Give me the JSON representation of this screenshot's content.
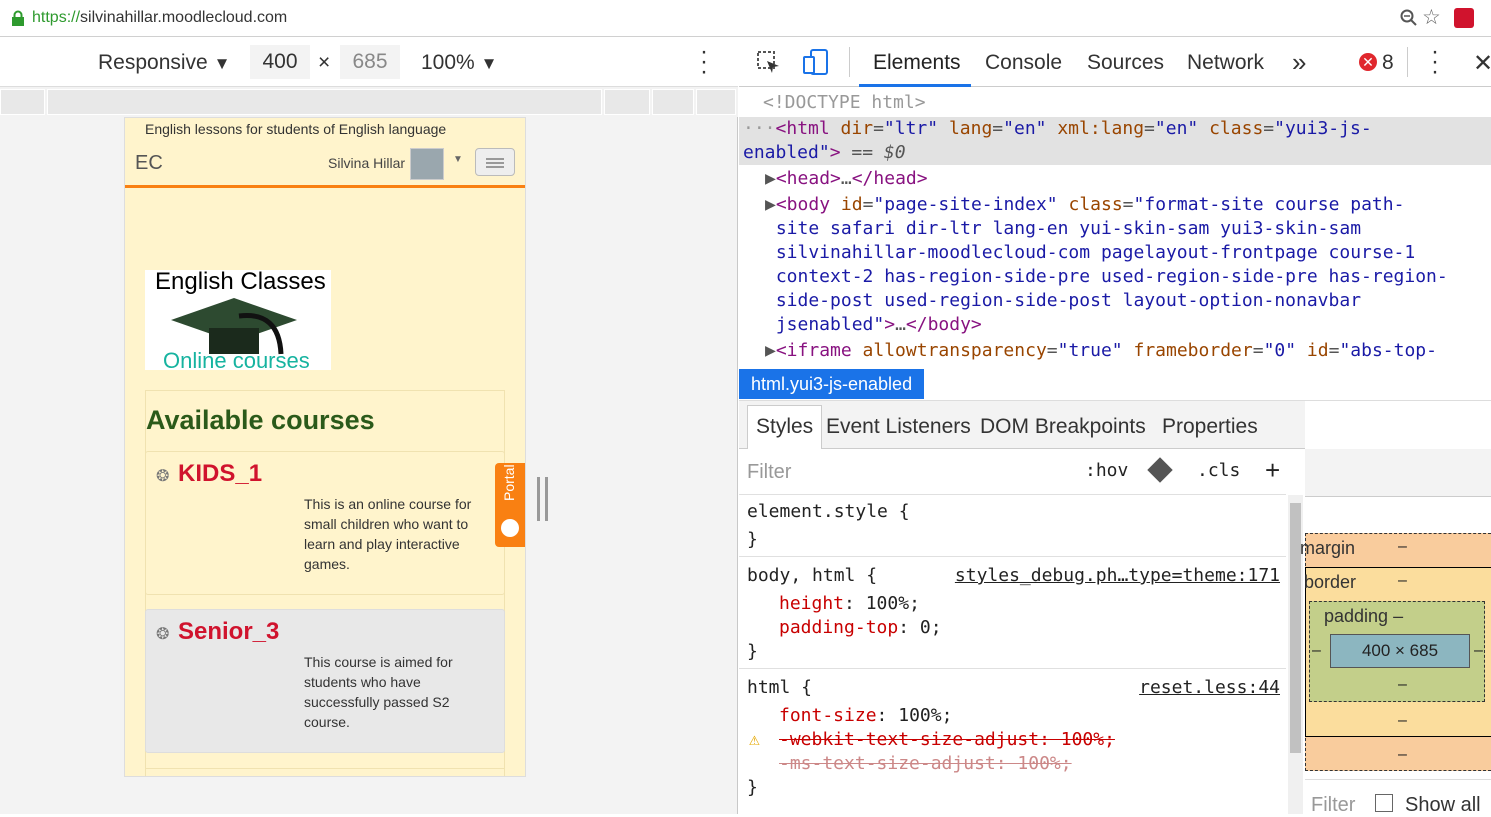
{
  "browser": {
    "url_scheme": "https://",
    "url_host": "silvinahillar.moodlecloud.com"
  },
  "device_toolbar": {
    "mode": "Responsive",
    "width": "400",
    "times": "×",
    "height": "685",
    "zoom": "100%"
  },
  "site": {
    "top_text": "English lessons for students of English language",
    "brand": "EC",
    "user": "Silvina Hillar",
    "logo_title": "English Classes",
    "logo_sub": "Online courses",
    "section_title": "Available courses",
    "portal_label": "Portal",
    "courses": [
      {
        "name": "KIDS_1",
        "desc": [
          "This is an online course for",
          "small children who want to",
          "learn and play interactive",
          "games."
        ]
      },
      {
        "name": "Senior_3",
        "desc": [
          "This course is aimed for",
          "students who have",
          "successfully passed S2",
          "course."
        ]
      }
    ]
  },
  "devtools": {
    "tabs": [
      "Elements",
      "Console",
      "Sources",
      "Network"
    ],
    "more": "»",
    "error_count": "8",
    "breadcrumb": "html.yui3-js-enabled",
    "subtabs": [
      "Styles",
      "Event Listeners",
      "DOM Breakpoints",
      "Properties"
    ],
    "filter_placeholder": "Filter",
    "hov": ":hov",
    "cls": ".cls",
    "plus": "+",
    "doctype": "<!DOCTYPE html>",
    "styles": {
      "element_style": "element.style {",
      "close": "}",
      "r1_sel": "body, html {",
      "r1_src": "styles_debug.ph…type=theme:171",
      "r1_p1": "height",
      "r1_v1": "100%;",
      "r1_p2": "padding-top",
      "r1_v2": "0;",
      "r2_sel": "html {",
      "r2_src": "reset.less:44",
      "r2_p1": "font-size",
      "r2_v1": "100%;",
      "r2_p2": "-webkit-text-size-adjust: 100%;",
      "r2_p3": "-ms-text-size-adjust: 100%;"
    },
    "boxmodel": {
      "margin": "margin",
      "border": "border",
      "padding": "padding",
      "dash": "–",
      "content": "400 × 685",
      "filter": "Filter",
      "show_all": "Show all"
    }
  }
}
